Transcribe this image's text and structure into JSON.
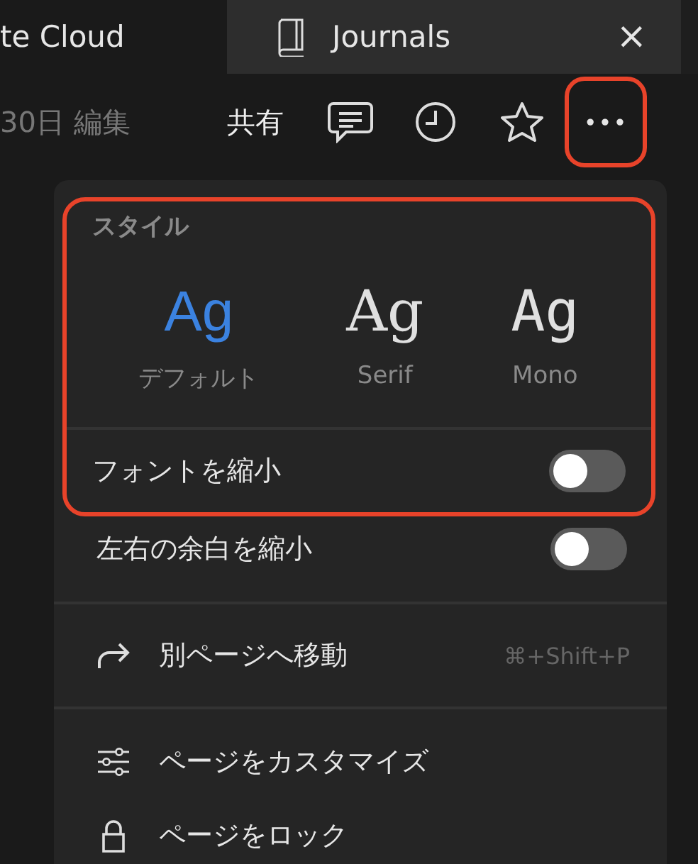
{
  "tabs": [
    {
      "label": "te Cloud",
      "selected": true
    },
    {
      "label": "Journals",
      "selected": false,
      "close": "×"
    }
  ],
  "toolbar": {
    "edited": "30日 編集",
    "share": "共有",
    "more": {
      "label": "•••",
      "highlighted": true
    }
  },
  "menu": {
    "style_section": {
      "title": "スタイル",
      "highlighted": true,
      "fonts": [
        {
          "kind": "sans",
          "sample": "Ag",
          "label": "デフォルト",
          "selected": true
        },
        {
          "kind": "serif",
          "sample": "Ag",
          "label": "Serif",
          "selected": false
        },
        {
          "kind": "mono",
          "sample": "Ag",
          "label": "Mono",
          "selected": false
        }
      ],
      "toggle": {
        "label": "フォントを縮小",
        "on": false
      }
    },
    "toggles": [
      {
        "label": "左右の余白を縮小",
        "on": false
      }
    ],
    "actions": [
      {
        "kind": "move",
        "label": "別ページへ移動",
        "shortcut": "⌘+Shift+P"
      },
      {
        "kind": "customize",
        "label": "ページをカスタマイズ"
      },
      {
        "kind": "lock",
        "label": "ページをロック"
      }
    ]
  }
}
